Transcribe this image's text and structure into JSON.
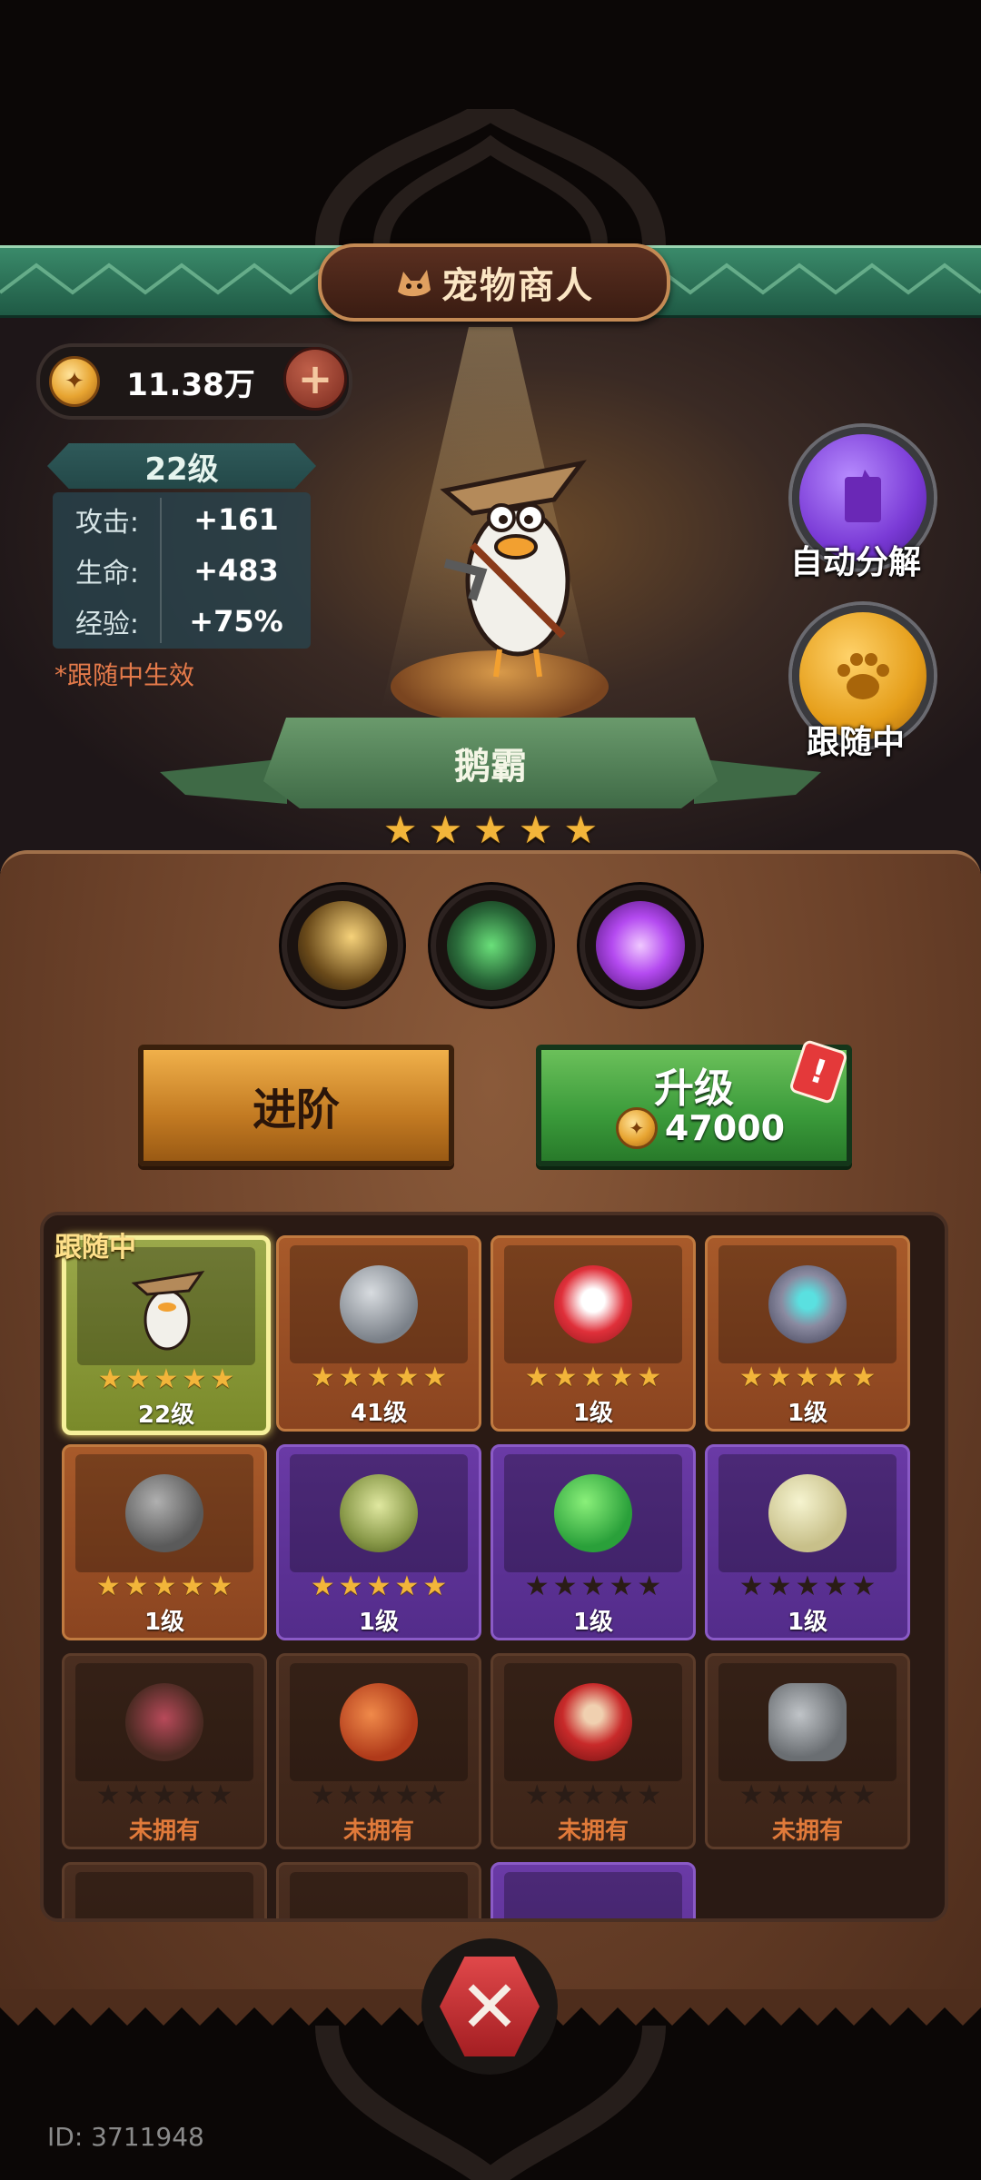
{
  "header": {
    "title": "宠物商人"
  },
  "currency": {
    "amount": "11.38万",
    "plus_label": "+"
  },
  "pet_info": {
    "level": "22级",
    "stats": [
      {
        "label": "攻击:",
        "value": "+161"
      },
      {
        "label": "生命:",
        "value": "+483"
      },
      {
        "label": "经验:",
        "value": "+75%"
      }
    ],
    "note": "*跟随中生效",
    "name": "鹅霸",
    "stars": 5
  },
  "side_buttons": {
    "decompose": "自动分解",
    "follow": "跟随中"
  },
  "actions": {
    "advance": "进阶",
    "upgrade": "升级",
    "upgrade_cost": "47000",
    "alert": "!"
  },
  "grid": {
    "following_tag": "跟随中",
    "cards": [
      {
        "level": "22级",
        "stars": 5,
        "rarity": "selected"
      },
      {
        "level": "41级",
        "stars": 5,
        "rarity": "orange"
      },
      {
        "level": "1级",
        "stars": 5,
        "rarity": "orange"
      },
      {
        "level": "1级",
        "stars": 5,
        "rarity": "orange"
      },
      {
        "level": "1级",
        "stars": 5,
        "rarity": "orange"
      },
      {
        "level": "1级",
        "stars": 5,
        "rarity": "purple"
      },
      {
        "level": "1级",
        "stars": 0,
        "rarity": "purple"
      },
      {
        "level": "1级",
        "stars": 0,
        "rarity": "purple"
      },
      {
        "level": "未拥有",
        "stars": 0,
        "rarity": "locked"
      },
      {
        "level": "未拥有",
        "stars": 0,
        "rarity": "locked"
      },
      {
        "level": "未拥有",
        "stars": 0,
        "rarity": "locked"
      },
      {
        "level": "未拥有",
        "stars": 0,
        "rarity": "locked"
      }
    ]
  },
  "footer": {
    "player_id": "ID: 3711948"
  },
  "colors": {
    "accent_green": "#3a9a3a",
    "accent_orange": "#c27a22",
    "star": "#f2b53a",
    "locked_text": "#e07a3a"
  }
}
